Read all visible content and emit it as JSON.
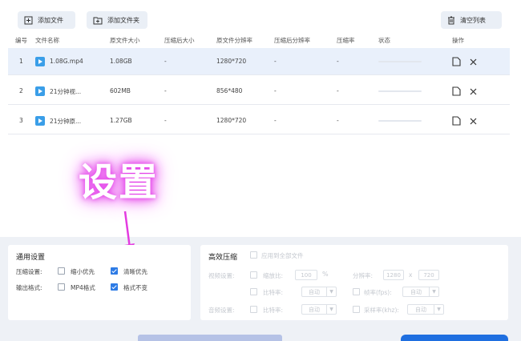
{
  "toolbar": {
    "add_file": "添加文件",
    "add_folder": "添加文件夹",
    "clear_list": "清空列表"
  },
  "table": {
    "headers": [
      "编号",
      "文件名称",
      "原文件大小",
      "压缩后大小",
      "原文件分辨率",
      "压缩后分辨率",
      "压缩率",
      "状态",
      "操作"
    ],
    "rows": [
      {
        "num": "1",
        "name": "1.08G.mp4",
        "size": "1.08GB",
        "csize": "-",
        "res": "1280*720",
        "cres": "-",
        "rate": "-"
      },
      {
        "num": "2",
        "name": "21分钟视...",
        "size": "602MB",
        "csize": "-",
        "res": "856*480",
        "cres": "-",
        "rate": "-"
      },
      {
        "num": "3",
        "name": "21分钟原...",
        "size": "1.27GB",
        "csize": "-",
        "res": "1280*720",
        "cres": "-",
        "rate": "-"
      }
    ]
  },
  "overlay": {
    "text": "设置"
  },
  "general": {
    "title": "通用设置",
    "compress_label": "压缩设置:",
    "opt_small": "缩小优先",
    "opt_clear": "清晰优先",
    "output_label": "输出格式:",
    "opt_mp4": "MP4格式",
    "opt_keep": "格式不变"
  },
  "hiperf": {
    "title": "高效压缩",
    "apply_all": "应用到全部文件",
    "video_label": "视频设置:",
    "scale_label": "缩放比:",
    "scale_value": "100",
    "percent": "%",
    "res_label": "分辨率:",
    "res_w": "1280",
    "res_x": "x",
    "res_h": "720",
    "bitrate_label": "比特率:",
    "auto": "自动",
    "fps_label": "帧率(fps):",
    "audio_label": "音频设置:",
    "samplerate_label": "采样率(khz):"
  }
}
